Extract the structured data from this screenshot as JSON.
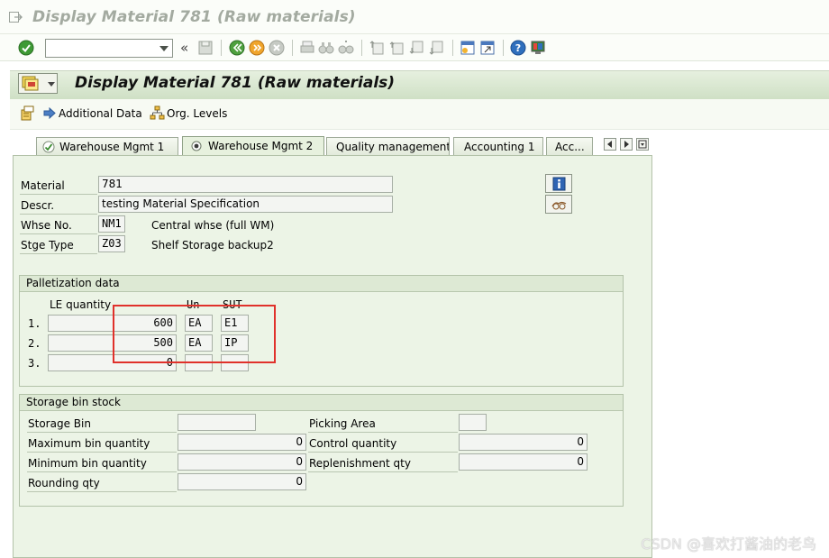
{
  "window": {
    "title": "Display Material 781 (Raw materials)"
  },
  "toolbar": {
    "command_field_value": "",
    "nav_symbol": "«"
  },
  "header": {
    "title": "Display Material 781 (Raw materials)"
  },
  "app_toolbar": {
    "additional_data": "Additional Data",
    "org_levels": "Org. Levels"
  },
  "tabs": [
    {
      "label": "Warehouse Mgmt 1",
      "active": false
    },
    {
      "label": "Warehouse Mgmt 2",
      "active": true
    },
    {
      "label": "Quality management",
      "active": false
    },
    {
      "label": "Accounting 1",
      "active": false
    },
    {
      "label": "Acc...",
      "active": false
    }
  ],
  "material": {
    "material_label": "Material",
    "material_value": "781",
    "descr_label": "Descr.",
    "descr_value": "testing Material Specification",
    "whse_label": "Whse No.",
    "whse_value": "NM1",
    "whse_text": "Central whse (full WM)",
    "stge_label": "Stge Type",
    "stge_value": "Z03",
    "stge_text": "Shelf Storage backup2"
  },
  "palletization": {
    "title": "Palletization data",
    "col_le": "LE quantity",
    "col_un": "Un",
    "col_sut": "SUT",
    "rows": [
      {
        "num": "1.",
        "qty": "600",
        "un": "EA",
        "sut": "E1"
      },
      {
        "num": "2.",
        "qty": "500",
        "un": "EA",
        "sut": "IP"
      },
      {
        "num": "3.",
        "qty": "0",
        "un": "",
        "sut": ""
      }
    ]
  },
  "bin_stock": {
    "title": "Storage bin stock",
    "storage_bin_label": "Storage Bin",
    "storage_bin_value": "",
    "picking_area_label": "Picking Area",
    "picking_area_value": "",
    "max_bin_label": "Maximum bin quantity",
    "max_bin_value": "0",
    "control_qty_label": "Control quantity",
    "control_qty_value": "0",
    "min_bin_label": "Minimum bin quantity",
    "min_bin_value": "0",
    "replenish_label": "Replenishment qty",
    "replenish_value": "0",
    "rounding_label": "Rounding qty",
    "rounding_value": "0"
  },
  "watermark": "CSDN @喜欢打酱油的老鸟"
}
